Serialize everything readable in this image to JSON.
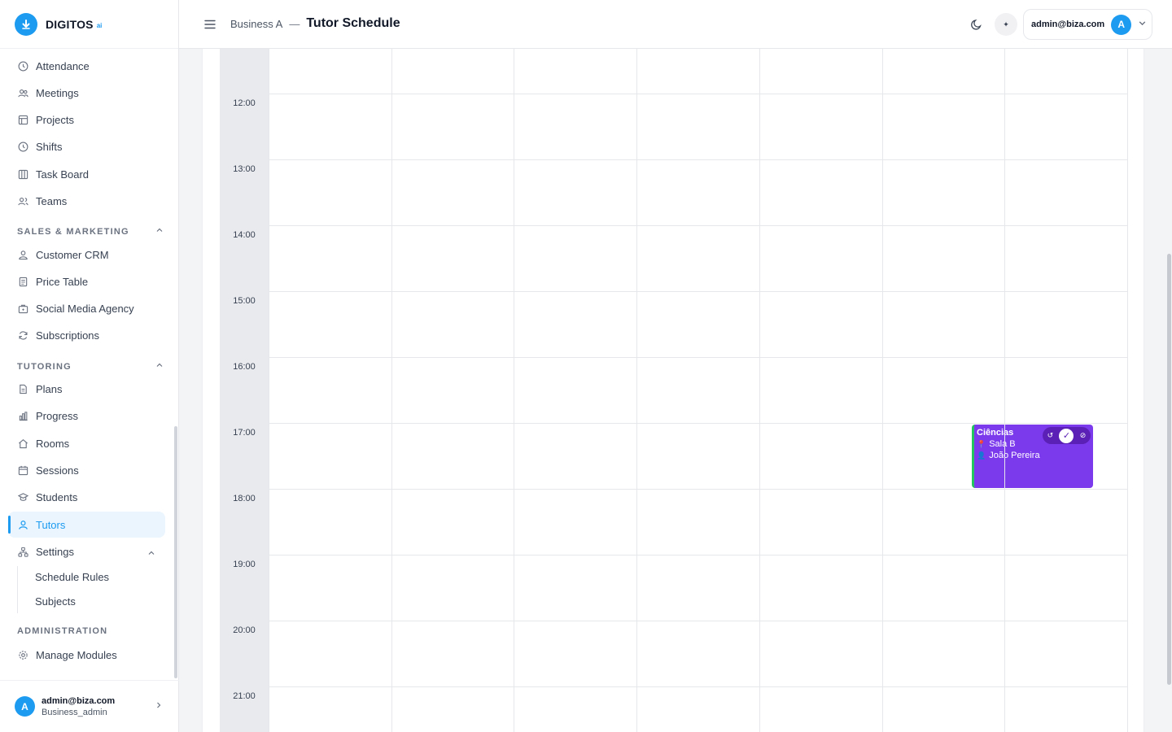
{
  "brand": {
    "name": "DIGITOS",
    "sub": "ai"
  },
  "header": {
    "business": "Business A",
    "separator": "—",
    "page_title": "Tutor Schedule",
    "user_email": "admin@biza.com",
    "avatar_initial": "A"
  },
  "sidebar": {
    "items": [
      {
        "label": "Attendance",
        "icon": "clock-icon"
      },
      {
        "label": "Meetings",
        "icon": "users-icon"
      },
      {
        "label": "Projects",
        "icon": "layout-icon"
      },
      {
        "label": "Shifts",
        "icon": "clock-icon"
      },
      {
        "label": "Task Board",
        "icon": "columns-icon"
      },
      {
        "label": "Teams",
        "icon": "users-icon"
      }
    ],
    "sales_title": "SALES & MARKETING",
    "sales_items": [
      {
        "label": "Customer CRM",
        "icon": "contacts-icon"
      },
      {
        "label": "Price Table",
        "icon": "document-icon"
      },
      {
        "label": "Social Media Agency",
        "icon": "briefcase-icon"
      },
      {
        "label": "Subscriptions",
        "icon": "refresh-icon"
      }
    ],
    "tutoring_title": "TUTORING",
    "tutoring_items": [
      {
        "label": "Plans",
        "icon": "file-icon"
      },
      {
        "label": "Progress",
        "icon": "bar-chart-icon"
      },
      {
        "label": "Rooms",
        "icon": "home-icon"
      },
      {
        "label": "Sessions",
        "icon": "calendar-icon"
      },
      {
        "label": "Students",
        "icon": "graduation-cap-icon"
      },
      {
        "label": "Tutors",
        "icon": "user-icon",
        "active": true
      }
    ],
    "settings": {
      "label": "Settings",
      "icon": "hierarchy-icon",
      "children": [
        "Schedule Rules",
        "Subjects"
      ]
    },
    "admin_title": "ADMINISTRATION",
    "admin_items": [
      {
        "label": "Manage Modules",
        "icon": "gear-icon"
      }
    ],
    "footer": {
      "email": "admin@biza.com",
      "role": "Business_admin",
      "avatar_initial": "A"
    }
  },
  "calendar": {
    "times": [
      "12:00",
      "13:00",
      "14:00",
      "15:00",
      "16:00",
      "17:00",
      "18:00",
      "19:00",
      "20:00",
      "21:00"
    ],
    "event": {
      "title": "Ciências",
      "room": "Sala B",
      "tutor": "João Pereira",
      "color": "#7c3aed",
      "status_color": "#22c55e"
    }
  },
  "colors": {
    "accent": "#1d9bf0",
    "event": "#7c3aed",
    "event_border": "#22c55e"
  }
}
